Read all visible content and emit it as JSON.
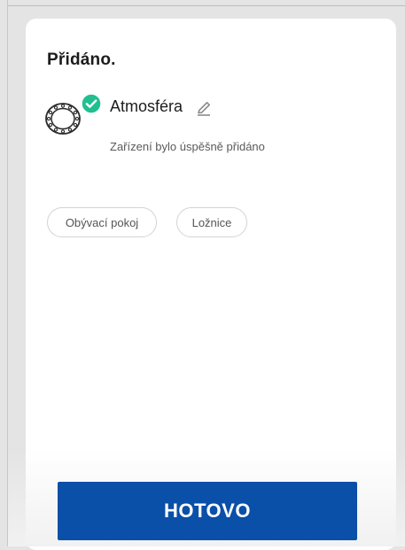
{
  "dialog": {
    "title": "Přidáno."
  },
  "device": {
    "name": "Atmosféra",
    "status": "Zařízení bylo úspěšně přidáno",
    "icon": "ring-light-icon",
    "check_color": "#1fbf8f"
  },
  "rooms": [
    {
      "label": "Obývací pokoj"
    },
    {
      "label": "Ložnice"
    }
  ],
  "actions": {
    "done_label": "HOTOVO",
    "done_color": "#0a4fa8"
  }
}
